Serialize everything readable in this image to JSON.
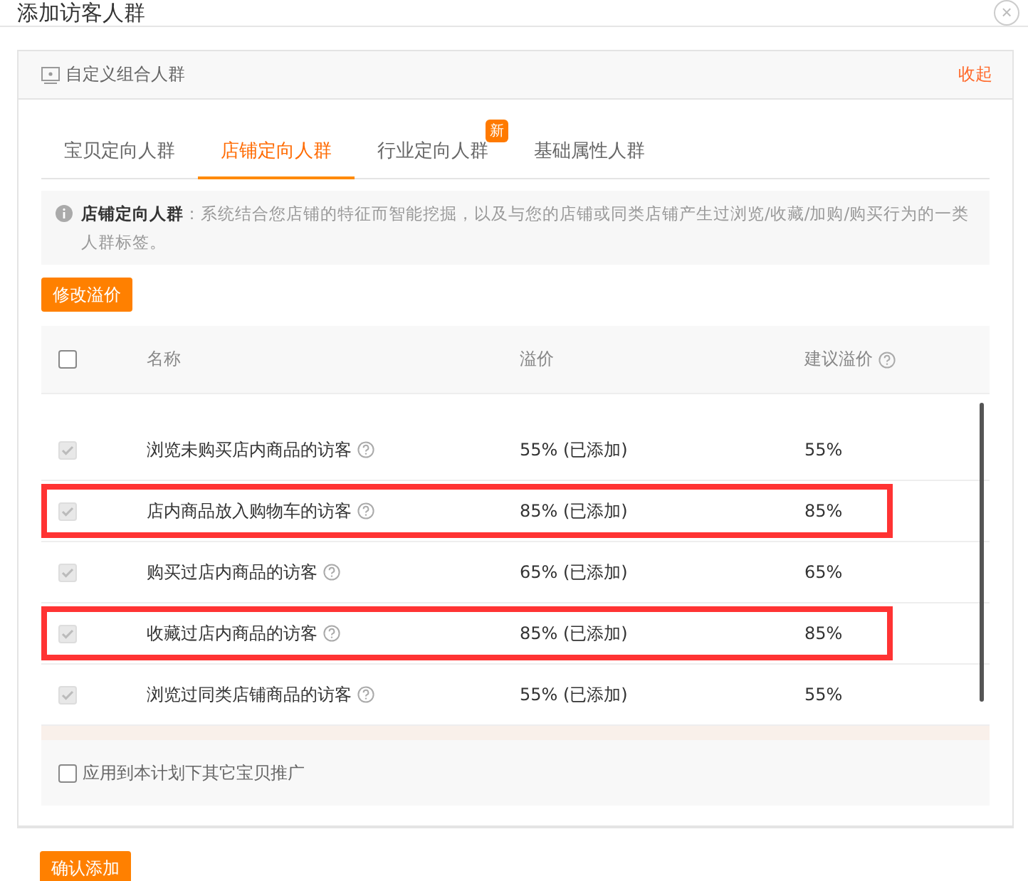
{
  "dialog": {
    "title": "添加访客人群",
    "close": "×"
  },
  "panel": {
    "title": "自定义组合人群",
    "collapse": "收起"
  },
  "tabs": [
    {
      "label": "宝贝定向人群",
      "selected": false
    },
    {
      "label": "店铺定向人群",
      "selected": true
    },
    {
      "label": "行业定向人群",
      "selected": false,
      "badge": "新"
    },
    {
      "label": "基础属性人群",
      "selected": false
    }
  ],
  "info": {
    "term": "店铺定向人群",
    "text": "：系统结合您店铺的特征而智能挖掘，以及与您的店铺或同类店铺产生过浏览/收藏/加购/购买行为的一类人群标签。"
  },
  "edit_button": "修改溢价",
  "table": {
    "header_checked": false,
    "columns": [
      "名称",
      "溢价",
      "建议溢价"
    ],
    "rows": [
      {
        "name": "浏览未购买店内商品的访客",
        "premium": "55% (已添加)",
        "suggested": "55%",
        "checked": true,
        "disabled": true,
        "highlighted": false
      },
      {
        "name": "店内商品放入购物车的访客",
        "premium": "85% (已添加)",
        "suggested": "85%",
        "checked": true,
        "disabled": true,
        "highlighted": true
      },
      {
        "name": "购买过店内商品的访客",
        "premium": "65% (已添加)",
        "suggested": "65%",
        "checked": true,
        "disabled": true,
        "highlighted": false
      },
      {
        "name": "收藏过店内商品的访客",
        "premium": "85% (已添加)",
        "suggested": "85%",
        "checked": true,
        "disabled": true,
        "highlighted": true
      },
      {
        "name": "浏览过同类店铺商品的访客",
        "premium": "55% (已添加)",
        "suggested": "55%",
        "checked": true,
        "disabled": true,
        "highlighted": false
      }
    ]
  },
  "apply_all": {
    "label": "应用到本计划下其它宝贝推广",
    "checked": false
  },
  "confirm_button": "确认添加"
}
